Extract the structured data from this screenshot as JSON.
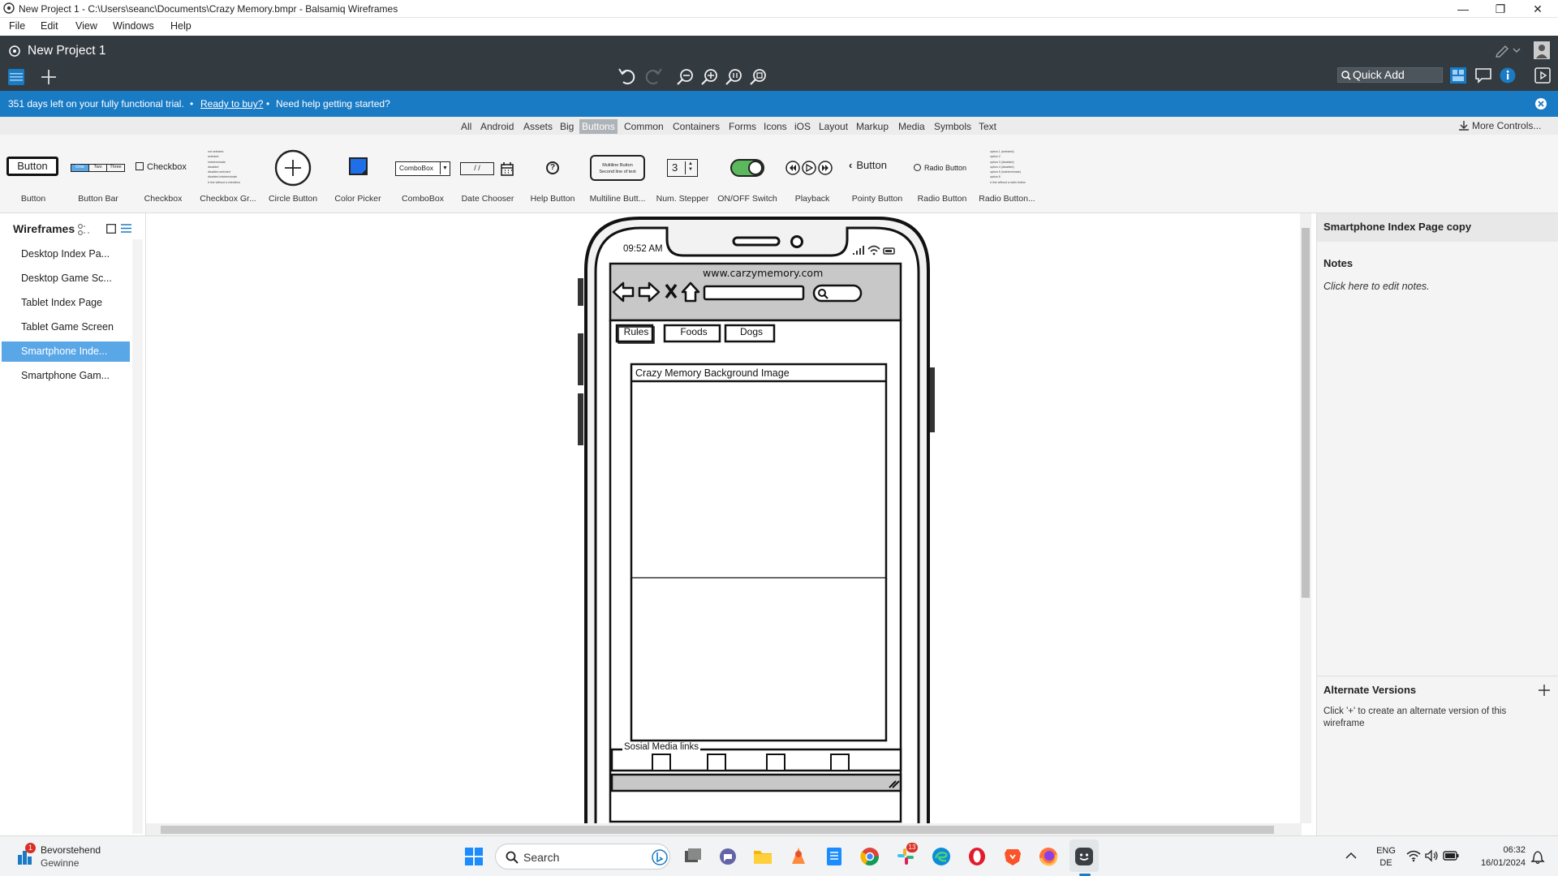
{
  "window": {
    "title": "New Project 1 - C:\\Users\\seanc\\Documents\\Crazy Memory.bmpr - Balsamiq Wireframes",
    "minimize_glyph": "—",
    "restore_glyph": "❐",
    "close_glyph": "✕"
  },
  "menu": [
    "File",
    "Edit",
    "View",
    "Windows",
    "Help"
  ],
  "appbar": {
    "project_title": "New Project 1",
    "quick_add_label": "Quick Add"
  },
  "trial": {
    "days_left_text": "351 days left on your fully functional trial.",
    "bullet": "•",
    "buy_link": "Ready to buy?",
    "help_text": "Need help getting started?"
  },
  "library": {
    "tabs": [
      "All",
      "Android",
      "Assets",
      "Big",
      "Buttons",
      "Common",
      "Containers",
      "Forms",
      "Icons",
      "iOS",
      "Layout",
      "Markup",
      "Media",
      "Symbols",
      "Text"
    ],
    "active_tab": "Buttons",
    "more_controls_label": "More Controls...",
    "items": [
      "Button",
      "Button Bar",
      "Checkbox",
      "Checkbox Gr...",
      "Circle Button",
      "Color Picker",
      "ComboBox",
      "Date Chooser",
      "Help Button",
      "Multiline Butt...",
      "Num. Stepper",
      "ON/OFF Switch",
      "Playback",
      "Pointy Button",
      "Radio Button",
      "Radio Button..."
    ],
    "previews": {
      "button": "Button",
      "buttonbar": [
        "One",
        "Two",
        "Three"
      ],
      "checkbox": "Checkbox",
      "checkbox_group": [
        "not selected",
        "selected",
        "indeterminate",
        "disabled",
        "disabled selected",
        "disabled indeterminate",
        "# line without a checkbox"
      ],
      "combobox": "ComboBox",
      "date": "/ /",
      "help": "?",
      "multiline": [
        "Multiline Button",
        "Second line of text"
      ],
      "stepper": "3",
      "pointy": "Button",
      "radio": "Radio Button",
      "radio_group": [
        "option 1 (selected)",
        "option 2",
        "option 3 (disabled)",
        "option 4 (disabled)",
        "option 5 (indeterminate)",
        "option 6",
        "# line without a radio button"
      ]
    }
  },
  "wireframes": {
    "title": "Wireframes",
    "items": [
      "Desktop Index Pa...",
      "Desktop Game Sc...",
      "Tablet Index Page",
      "Tablet Game Screen",
      "Smartphone Inde...",
      "Smartphone Gam..."
    ],
    "selected_index": 4
  },
  "mockup": {
    "time": "09:52 AM",
    "url": "www.carzymemory.com",
    "nav_buttons": [
      "Rules",
      "Foods",
      "Dogs"
    ],
    "image_title": "Crazy Memory Background Image",
    "social_title": "Sosial Media links",
    "social_box_count": 4
  },
  "right_panel": {
    "title": "Smartphone Index Page  copy",
    "notes_heading": "Notes",
    "notes_placeholder": "Click here to edit notes.",
    "alt_heading": "Alternate Versions",
    "alt_text": "Click '+' to create an alternate version of this wireframe"
  },
  "taskbar": {
    "weather_title": "Bevorstehend",
    "weather_sub": "Gewinne",
    "weather_badge": "1",
    "search_placeholder": "Search",
    "badge_13": "13",
    "lang_top": "ENG",
    "lang_bottom": "DE",
    "time": "06:32",
    "date": "16/01/2024"
  },
  "colors": {
    "appbar": "#333a40",
    "trial_banner": "#1a7bc5",
    "selected_item": "#5aa7e8",
    "switch_on": "#5cb85c"
  }
}
